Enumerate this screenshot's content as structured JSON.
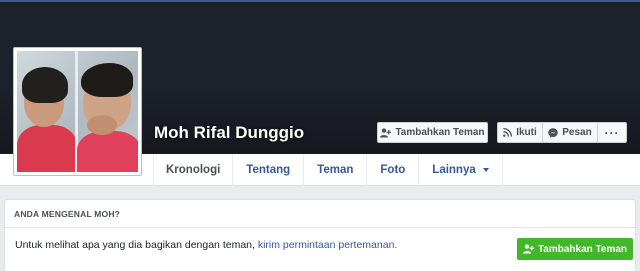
{
  "profile": {
    "name": "Moh Rifal Dunggio"
  },
  "actions": {
    "add_friend_label": "Tambahkan Teman",
    "follow_label": "Ikuti",
    "message_label": "Pesan",
    "more_label": "···"
  },
  "tabs": [
    {
      "label": "Kronologi"
    },
    {
      "label": "Tentang"
    },
    {
      "label": "Teman"
    },
    {
      "label": "Foto"
    },
    {
      "label": "Lainnya"
    }
  ],
  "know_card": {
    "heading": "ANDA MENGENAL MOH?",
    "text_prefix": "Untuk melihat apa yang dia bagikan dengan teman,",
    "link_text": "kirim permintaan pertemanan.",
    "button_label": "Tambahkan Teman"
  },
  "colors": {
    "cover": "#1d2129",
    "link": "#365899",
    "green_button": "#42b72a",
    "shirt_pink": "#e0415a"
  },
  "icons": [
    "add-friend-icon",
    "follow-icon",
    "messenger-icon",
    "more-icon",
    "caret-down-icon"
  ]
}
